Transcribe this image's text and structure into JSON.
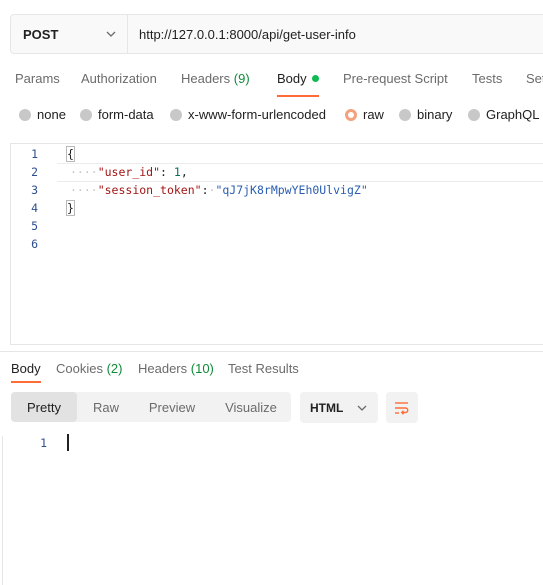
{
  "request": {
    "method": "POST",
    "url": "http://127.0.0.1:8000/api/get-user-info"
  },
  "request_tabs": [
    {
      "label": "Params",
      "count": ""
    },
    {
      "label": "Authorization",
      "count": ""
    },
    {
      "label": "Headers",
      "count": "(9)"
    },
    {
      "label": "Body",
      "count": ""
    },
    {
      "label": "Pre-request Script",
      "count": ""
    },
    {
      "label": "Tests",
      "count": ""
    },
    {
      "label": "Set",
      "count": ""
    }
  ],
  "body_types": [
    {
      "label": "none"
    },
    {
      "label": "form-data"
    },
    {
      "label": "x-www-form-urlencoded"
    },
    {
      "label": "raw",
      "selected": true
    },
    {
      "label": "binary"
    },
    {
      "label": "GraphQL"
    }
  ],
  "editor": {
    "line_numbers": [
      "1",
      "2",
      "3",
      "4",
      "5",
      "6"
    ],
    "lines": {
      "open_brace": "{",
      "indent_dots": "····",
      "key1": "\"user_id\"",
      "colon1": ": ",
      "val1": "1",
      "comma1": ",",
      "key2": "\"session_token\"",
      "colon2": ":",
      "sep_dot": "·",
      "val2": "\"qJ7jK8rMpwYEh0UlvigZ\"",
      "close_brace": "}"
    }
  },
  "response_tabs": [
    {
      "label": "Body",
      "count": ""
    },
    {
      "label": "Cookies",
      "count": "(2)"
    },
    {
      "label": "Headers",
      "count": "(10)"
    },
    {
      "label": "Test Results",
      "count": ""
    }
  ],
  "view_modes": [
    "Pretty",
    "Raw",
    "Preview",
    "Visualize"
  ],
  "format": "HTML",
  "response_editor": {
    "line_numbers": [
      "1"
    ]
  },
  "colors": {
    "accent": "#ff6c37",
    "success": "#0cbb52",
    "count_green": "#0f8a3a"
  }
}
